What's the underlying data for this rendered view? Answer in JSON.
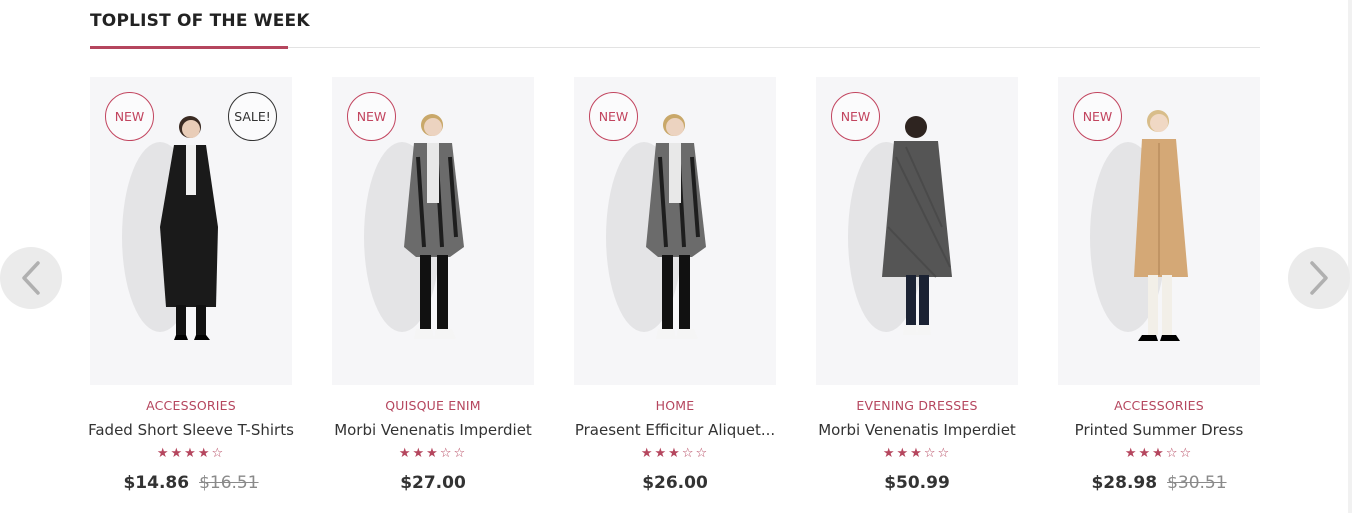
{
  "section": {
    "title": "TOPLIST OF THE WEEK"
  },
  "carousel": {
    "prev_icon": "chevron-left-icon",
    "next_icon": "chevron-right-icon"
  },
  "colors": {
    "accent": "#b5465e",
    "text": "#333333",
    "muted": "#8a8a8a",
    "image_bg": "#f6f6f8"
  },
  "products": [
    {
      "badge_new": "NEW",
      "badge_sale": "SALE!",
      "category": "ACCESSORIES",
      "name": "Faded Short Sleeve T-Shirts",
      "rating": 4,
      "max_rating": 5,
      "price": "$14.86",
      "old_price": "$16.51",
      "coat_color": "#1a1a1a",
      "image_alt": "model in black coat"
    },
    {
      "badge_new": "NEW",
      "category": "QUISQUE ENIM",
      "name": "Morbi Venenatis Imperdiet",
      "rating": 3,
      "max_rating": 5,
      "price": "$27.00",
      "coat_color": "#6b6b6b",
      "image_alt": "model in patterned coat"
    },
    {
      "badge_new": "NEW",
      "category": "HOME",
      "name": "Praesent Efficitur Aliquet...",
      "rating": 3,
      "max_rating": 5,
      "price": "$26.00",
      "coat_color": "#6b6b6b",
      "image_alt": "model in patterned coat"
    },
    {
      "badge_new": "NEW",
      "category": "EVENING DRESSES",
      "name": "Morbi Venenatis Imperdiet",
      "rating": 3,
      "max_rating": 5,
      "price": "$50.99",
      "coat_color": "#555555",
      "image_alt": "model in grey tweed coat, back view"
    },
    {
      "badge_new": "NEW",
      "category": "ACCESSORIES",
      "name": "Printed Summer Dress",
      "rating": 3,
      "max_rating": 5,
      "price": "$28.98",
      "old_price": "$30.51",
      "coat_color": "#d4a876",
      "image_alt": "model in camel coat"
    }
  ]
}
